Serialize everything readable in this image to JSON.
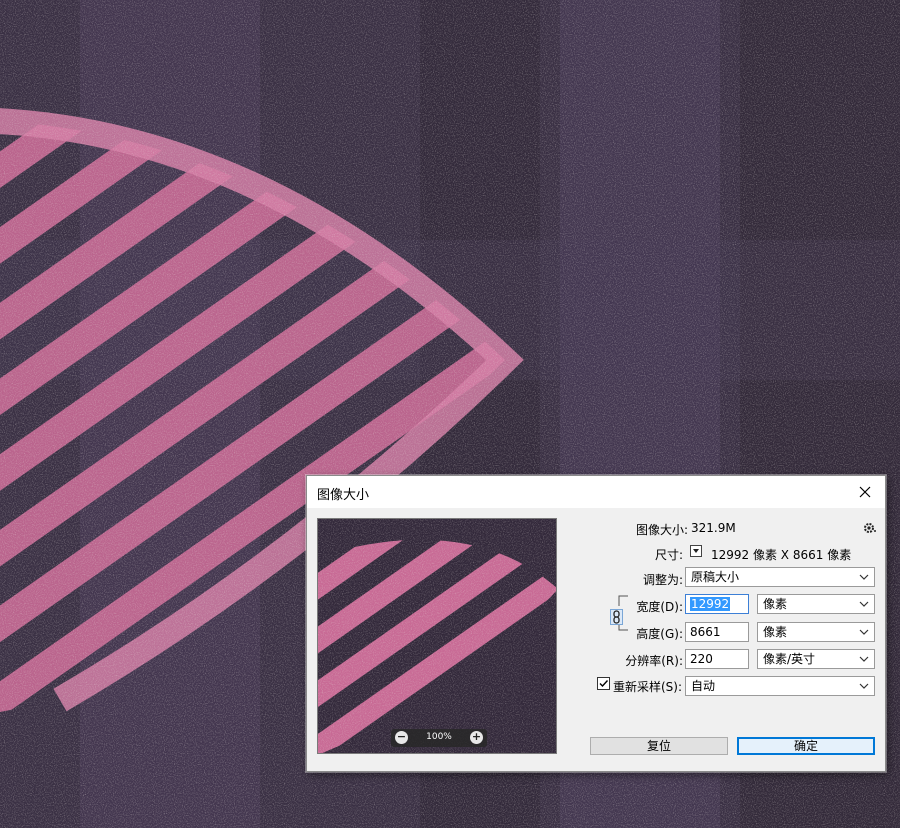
{
  "dialog": {
    "title": "图像大小",
    "image_size_label": "图像大小:",
    "image_size_value": "321.9M",
    "dimensions_label": "尺寸:",
    "dimensions_value": "12992 像素  X  8661 像素",
    "fit_to_label": "调整为:",
    "fit_to_value": "原稿大小",
    "width_label": "宽度(D):",
    "width_value": "12992",
    "width_unit": "像素",
    "height_label": "高度(G):",
    "height_value": "8661",
    "height_unit": "像素",
    "resolution_label": "分辨率(R):",
    "resolution_value": "220",
    "resolution_unit": "像素/英寸",
    "resample_label": "重新采样(S):",
    "resample_checked": true,
    "resample_value": "自动",
    "zoom_level": "100%",
    "reset_button": "复位",
    "ok_button": "确定"
  },
  "icons": {
    "close": "close-icon",
    "settings": "gear-icon",
    "dimensions_dropdown": "chevron-down-icon",
    "link": "chain-link-icon",
    "zoom_out": "minus-icon",
    "zoom_in": "plus-icon"
  },
  "colors": {
    "artwork_background": "#3a3044",
    "artwork_stripe": "#d9739f",
    "selection_highlight": "#3399ff",
    "default_button_border": "#0078d7"
  }
}
